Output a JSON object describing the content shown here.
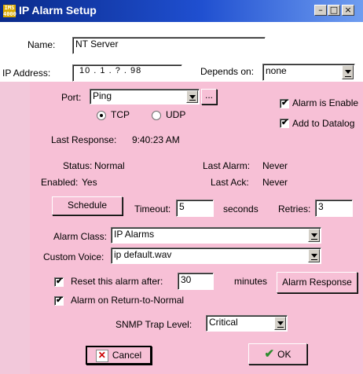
{
  "window": {
    "title": "IP Alarm Setup",
    "app_icon_text": "IMS 4000"
  },
  "name_label": "Name:",
  "name_value": "NT Server",
  "ip_label": "IP Address:",
  "ip_value": "10 . 1 . ? . 98",
  "depends_label": "Depends on:",
  "depends_value": "none",
  "port_label": "Port:",
  "port_value": "Ping",
  "port_browse": "...",
  "tcp_label": "TCP",
  "udp_label": "UDP",
  "alarm_enable_label": "Alarm is Enable",
  "add_datalog_label": "Add to Datalog",
  "last_response_label": "Last Response:",
  "last_response_value": "9:40:23 AM",
  "status_label": "Status:",
  "status_value": "Normal",
  "last_alarm_label": "Last Alarm:",
  "last_alarm_value": "Never",
  "enabled_label": "Enabled:",
  "enabled_value": "Yes",
  "last_ack_label": "Last Ack:",
  "last_ack_value": "Never",
  "schedule_button": "Schedule",
  "timeout_label": "Timeout:",
  "timeout_value": "5",
  "seconds_label": "seconds",
  "retries_label": "Retries:",
  "retries_value": "3",
  "alarm_class_label": "Alarm Class:",
  "alarm_class_value": "IP Alarms",
  "custom_voice_label": "Custom Voice:",
  "custom_voice_value": "ip default.wav",
  "reset_label": "Reset this alarm after:",
  "reset_value": "30",
  "minutes_label": "minutes",
  "alarm_response_button": "Alarm Response",
  "alarm_return_label": "Alarm on Return-to-Normal",
  "snmp_label": "SNMP Trap Level:",
  "snmp_value": "Critical",
  "cancel_button": "Cancel",
  "ok_button": "OK",
  "checkbox_mark": "✔",
  "colors": {
    "title_bar": "#1f4fd0",
    "panel": "#f7c0d6",
    "cancel_x": "#cc0000",
    "ok_check": "#2e8b2e"
  }
}
